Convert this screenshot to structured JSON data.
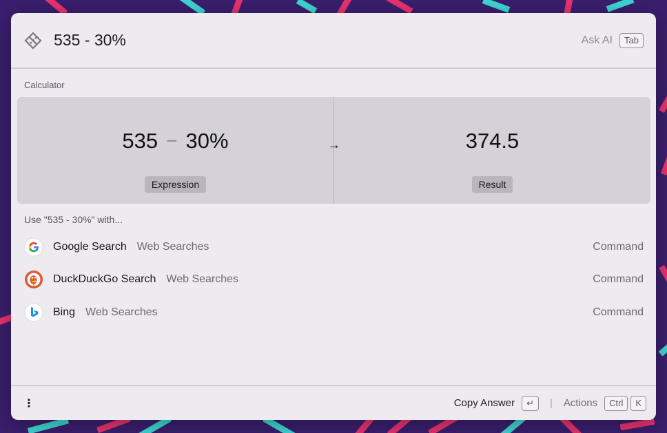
{
  "search": {
    "query": "535 - 30%"
  },
  "topbar": {
    "ask_ai_label": "Ask AI",
    "ask_ai_key": "Tab"
  },
  "calculator": {
    "section_label": "Calculator",
    "expression_left": "535",
    "expression_operator": "−",
    "expression_right": "30%",
    "expression_tag": "Expression",
    "result_value": "374.5",
    "result_tag": "Result",
    "arrow": "→"
  },
  "use_with": {
    "label": "Use \"535 - 30%\" with..."
  },
  "results": [
    {
      "title": "Google Search",
      "subtitle": "Web Searches",
      "type": "Command",
      "icon": "google-icon"
    },
    {
      "title": "DuckDuckGo Search",
      "subtitle": "Web Searches",
      "type": "Command",
      "icon": "duckduckgo-icon"
    },
    {
      "title": "Bing",
      "subtitle": "Web Searches",
      "type": "Command",
      "icon": "bing-icon"
    }
  ],
  "footer": {
    "more_label": "⋮",
    "copy_answer_label": "Copy Answer",
    "copy_answer_key": "↵",
    "separator": "|",
    "actions_label": "Actions",
    "actions_key_1": "Ctrl",
    "actions_key_2": "K"
  },
  "colors": {
    "background": "#3a1f6e",
    "window": "#edeaf0",
    "calc_panel": "#d4d1d9",
    "confetti_pink": "#e8336d",
    "confetti_cyan": "#3fd6d0"
  }
}
